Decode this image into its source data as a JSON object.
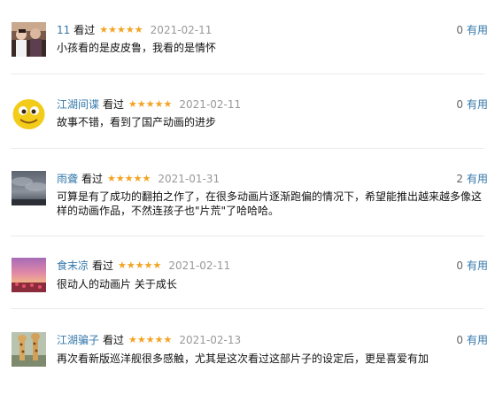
{
  "reviews": [
    {
      "username": "11",
      "watched_label": "看过",
      "rating": 5,
      "date": "2021-02-11",
      "votes": "0",
      "useful_label": "有用",
      "content": "小孩看的是皮皮鲁，我看的是情怀",
      "avatar": "photo-avatar-people"
    },
    {
      "username": "江湖间谍",
      "watched_label": "看过",
      "rating": 5,
      "date": "2021-02-11",
      "votes": "0",
      "useful_label": "有用",
      "content": "故事不错，看到了国产动画的进步",
      "avatar": "cartoon-face-avatar"
    },
    {
      "username": "雨聋",
      "watched_label": "看过",
      "rating": 5,
      "date": "2021-01-31",
      "votes": "2",
      "useful_label": "有用",
      "content": "可算是有了成功的翻拍之作了，在很多动画片逐渐跑偏的情况下，希望能推出越来越多像这样的动画作品，不然连孩子也\"片荒\"了哈哈哈。",
      "avatar": "cloudy-sky-avatar"
    },
    {
      "username": "食末凉",
      "watched_label": "看过",
      "rating": 5,
      "date": "2021-02-11",
      "votes": "0",
      "useful_label": "有用",
      "content": "很动人的动画片 关于成长",
      "avatar": "sunset-avatar"
    },
    {
      "username": "江湖骗子",
      "watched_label": "看过",
      "rating": 5,
      "date": "2021-02-13",
      "votes": "0",
      "useful_label": "有用",
      "content": "再次看新版巡洋舰很多感触，尤其是这次看过这部片子的设定后，更是喜爱有加",
      "avatar": "giraffe-avatar"
    }
  ],
  "colors": {
    "link": "#3377aa",
    "star": "#f4a321",
    "date": "#999999",
    "separator": "#eaeaea"
  }
}
